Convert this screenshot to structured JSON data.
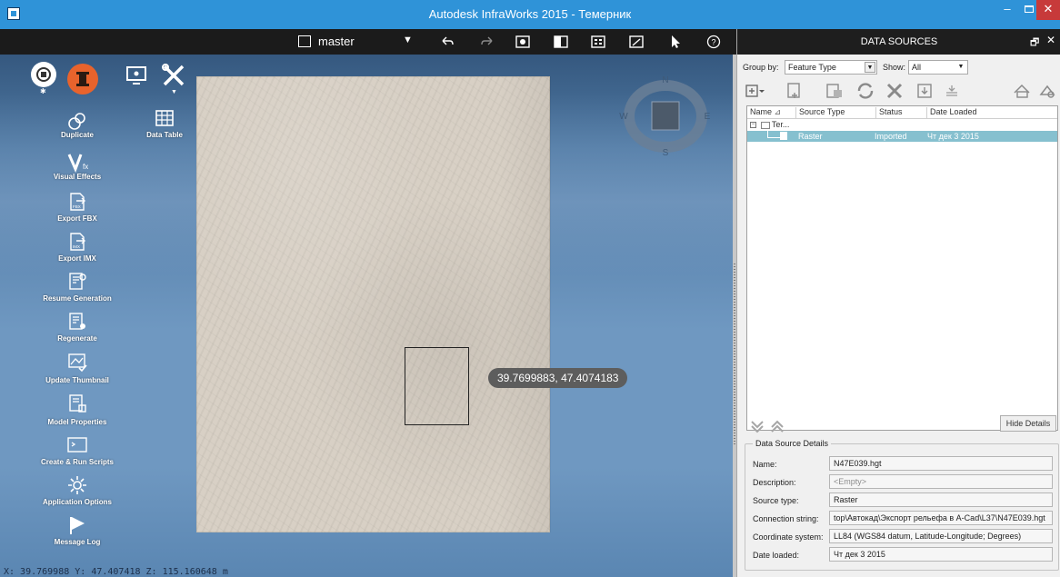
{
  "window": {
    "title": "Autodesk InfraWorks 2015 - Темерник",
    "minimize_label": "–",
    "close_label": "✕"
  },
  "viewport_toolbar": {
    "branch_label": "master",
    "dropdown_glyph": "▼",
    "tools": [
      "undo-icon",
      "redo-icon",
      "camera-icon",
      "split-view-icon",
      "grid-view-icon",
      "bookmark-icon",
      "pointer-icon",
      "help-icon"
    ]
  },
  "tool_panel": {
    "items": [
      {
        "label": "Duplicate",
        "icon": "duplicate-icon"
      },
      {
        "label": "Data Table",
        "icon": "data-table-icon"
      },
      {
        "label": "Visual Effects",
        "icon": "visual-effects-icon"
      },
      {
        "label": "Export FBX",
        "icon": "export-fbx-icon"
      },
      {
        "label": "Export IMX",
        "icon": "export-imx-icon"
      },
      {
        "label": "Resume Generation",
        "icon": "resume-generation-icon"
      },
      {
        "label": "Regenerate",
        "icon": "regenerate-icon"
      },
      {
        "label": "Update Thumbnail",
        "icon": "update-thumbnail-icon"
      },
      {
        "label": "Model Properties",
        "icon": "model-properties-icon"
      },
      {
        "label": "Create & Run Scripts",
        "icon": "scripts-icon"
      },
      {
        "label": "Application Options",
        "icon": "gear-icon"
      },
      {
        "label": "Message Log",
        "icon": "flag-icon"
      }
    ]
  },
  "compass": {
    "n": "N",
    "e": "E",
    "s": "S",
    "w": "W"
  },
  "viewport": {
    "coordinate_tooltip": "39.7699883, 47.4074183",
    "status_line": "X: 39.769988 Y: 47.407418 Z: 115.160648 m"
  },
  "data_sources": {
    "title": "DATA SOURCES",
    "pin_glyph": "🗗",
    "close_glyph": "✕",
    "group_by_label": "Group by:",
    "group_by_value": "Feature Type",
    "show_label": "Show:",
    "show_value": "All",
    "dropdown_glyph": "▼",
    "columns": [
      "Name",
      "Source Type",
      "Status",
      "Date Loaded"
    ],
    "tree_root": "Ter...",
    "rows": [
      {
        "name": "",
        "source_type": "Raster",
        "status": "Imported",
        "date_loaded": "Чт дек 3 2015"
      }
    ],
    "hide_details_label": "Hide Details",
    "details": {
      "legend": "Data Source Details",
      "fields": [
        {
          "label": "Name:",
          "value": "N47E039.hgt"
        },
        {
          "label": "Description:",
          "value": "<Empty>"
        },
        {
          "label": "Source type:",
          "value": "Raster"
        },
        {
          "label": "Connection string:",
          "value": "top\\Автокад\\Экспорт рельефа в A-Cad\\L37\\N47E039.hgt"
        },
        {
          "label": "Coordinate system:",
          "value": "LL84 (WGS84 datum, Latitude-Longitude; Degrees)"
        },
        {
          "label": "Date loaded:",
          "value": "Чт дек 3 2015"
        }
      ]
    }
  },
  "colors": {
    "titlebar": "#2f93d8",
    "selected_row": "#86c0cf",
    "accent_orange": "#e8632c",
    "close_red": "#c73a3a"
  }
}
